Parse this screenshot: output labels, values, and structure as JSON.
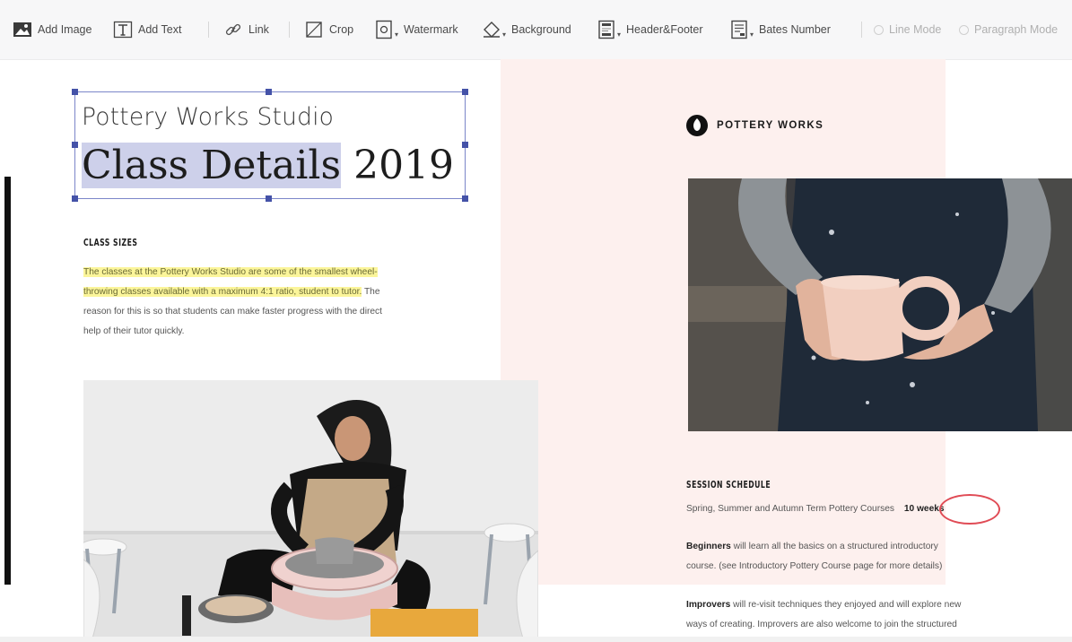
{
  "toolbar": {
    "add_image": "Add Image",
    "add_text": "Add Text",
    "link": "Link",
    "crop": "Crop",
    "watermark": "Watermark",
    "background": "Background",
    "header_footer": "Header&Footer",
    "bates_number": "Bates Number",
    "line_mode": "Line Mode",
    "paragraph_mode": "Paragraph Mode"
  },
  "document": {
    "studio_name": "Pottery Works Studio",
    "title_highlighted": "Class Details",
    "title_year": "2019",
    "class_sizes": {
      "heading": "CLASS SIZES",
      "line1": "The classes at the Pottery Works Studio are some of the smallest wheel-",
      "line2_highlight": "throwing classes available with a maximum 4:1 ratio, student to tutor.",
      "line2_rest": " The",
      "line3": "reason for this is so that students can make faster progress with the direct",
      "line4": "help of their tutor quickly."
    },
    "brand_name": "POTTERY WORKS",
    "session": {
      "heading": "SESSION SCHEDULE",
      "line1": "Spring, Summer and Autumn Term Pottery Courses",
      "duration": "10 weeks",
      "beginners_label": "Beginners",
      "beginners_line1": " will learn all the basics on a structured introductory",
      "beginners_line2": "course. (see Introductory Pottery Course page for more details)",
      "improvers_label": "Improvers",
      "improvers_line1": " will re-visit techniques they enjoyed and will explore new",
      "improvers_line2": "ways of creating. Improvers are also welcome to join the structured"
    }
  },
  "colors": {
    "selection": "#4452a8",
    "title_highlight": "#cdd0ea",
    "text_highlight": "#fbf59a",
    "pink_panel": "#fdf0ee",
    "circle_annotation": "#e04b55"
  }
}
